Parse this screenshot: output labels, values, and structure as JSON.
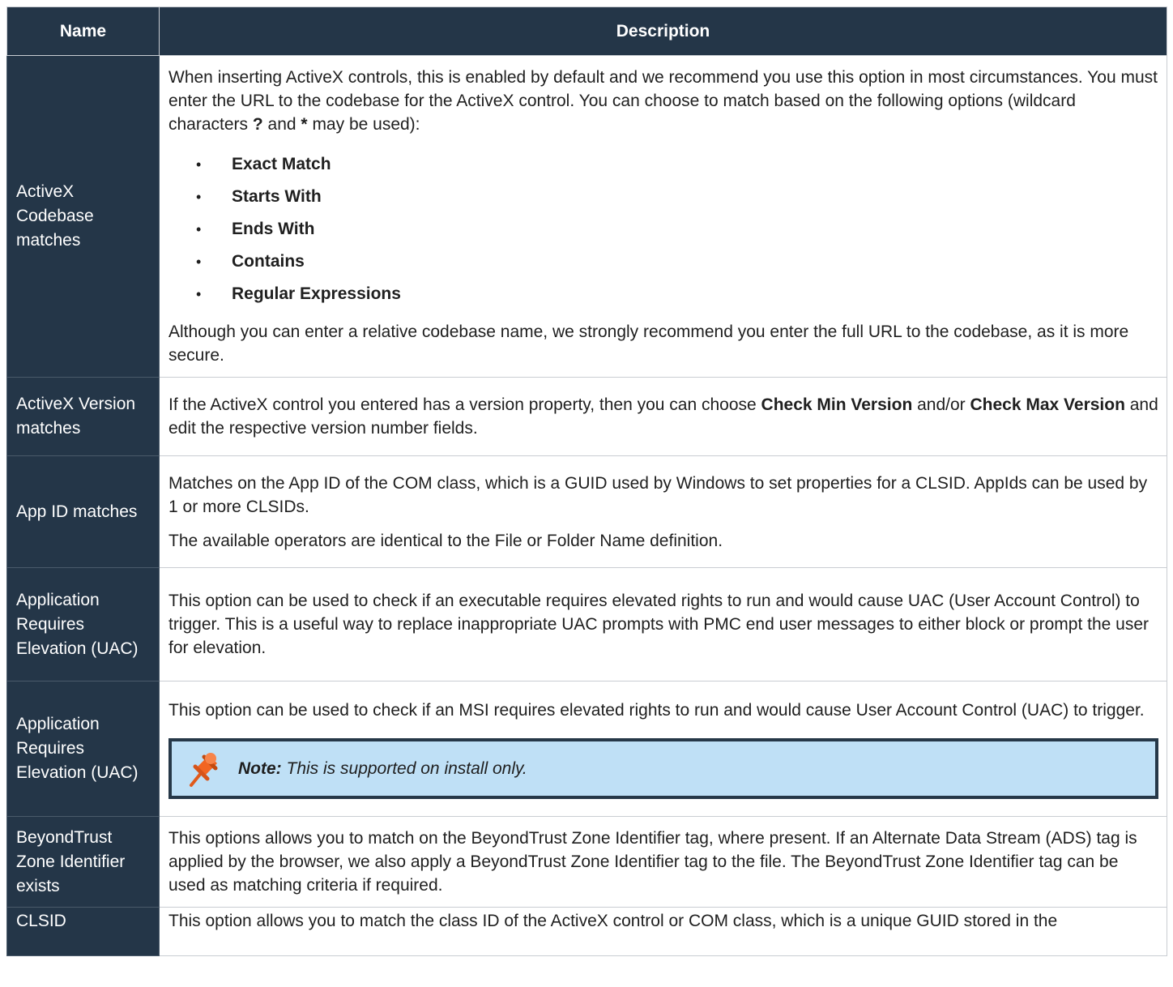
{
  "headers": {
    "name": "Name",
    "description": "Description"
  },
  "rows": [
    {
      "name": "ActiveX Codebase matches",
      "intro": {
        "a": "When inserting ActiveX controls, this is enabled by default and we recommend you use this option in most circumstances. You must enter the URL to the codebase for the ActiveX control. You can choose to match based on the following options (wildcard characters ",
        "b1": "?",
        "c": " and ",
        "b2": "*",
        "d": " may be used):"
      },
      "options": [
        "Exact Match",
        "Starts With",
        "Ends With",
        "Contains",
        "Regular Expressions"
      ],
      "outro": "Although you can enter a relative codebase name, we strongly recommend you enter the full URL to the codebase, as it is more secure."
    },
    {
      "name": "ActiveX Version matches",
      "a": "If the ActiveX control you entered has a version property, then you can choose ",
      "b1": "Check Min Version",
      "c": " and/or ",
      "b2": "Check Max Version",
      "d": " and edit the respective version number fields."
    },
    {
      "name": "App ID matches",
      "p1": "Matches on the App ID of the COM class, which is a GUID used by Windows to set properties for a CLSID. AppIds can be used by 1 or more CLSIDs.",
      "p2": "The available operators are identical to the File or Folder Name definition."
    },
    {
      "name": "Application Requires Elevation (UAC)",
      "text": "This option can be used to check if an executable requires elevated rights to run and would cause UAC (User Account Control) to trigger. This is a useful way to replace inappropriate UAC prompts with PMC end user messages to either block or prompt the user for elevation."
    },
    {
      "name": "Application Requires Elevation (UAC)",
      "text": "This option can be used to check if an MSI requires elevated rights to run and would cause User Account Control (UAC) to trigger.",
      "note": {
        "icon": "pushpin-icon",
        "label": "Note:",
        "text": " This is supported on install only."
      }
    },
    {
      "name": "BeyondTrust Zone Identifier exists",
      "text": "This options allows you to match on the BeyondTrust Zone Identifier tag, where present. If an Alternate Data Stream (ADS) tag is applied by the browser, we also apply a BeyondTrust Zone Identifier tag to the file. The BeyondTrust Zone Identifier tag can be used as matching criteria if required."
    },
    {
      "name": "CLSID",
      "text": "This option allows you to match the class ID of the ActiveX control or COM class, which is a unique GUID stored in the"
    }
  ],
  "bullet_char": "•",
  "colors": {
    "header_bg": "#243648",
    "note_bg": "#bfe0f6",
    "note_border": "#263848",
    "pin": "#f26522"
  }
}
